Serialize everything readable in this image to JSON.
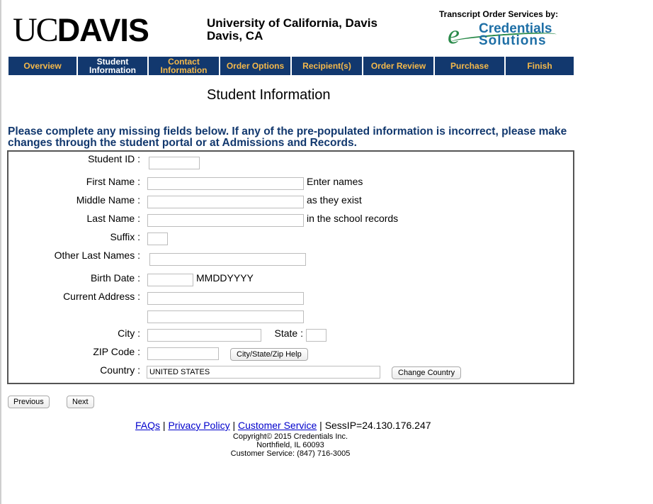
{
  "header": {
    "logo_uc": "UC",
    "logo_davis": "DAVIS",
    "university_line1": "University of California, Davis",
    "university_line2": "Davis, CA",
    "services_label": "Transcript Order Services by:",
    "provider_e": "e",
    "provider_word1": "Credentials",
    "provider_word2": "Solutions"
  },
  "nav": {
    "tabs": [
      {
        "label": "Overview",
        "active": false
      },
      {
        "label": "Student Information",
        "active": true
      },
      {
        "label": "Contact Information",
        "active": false
      },
      {
        "label": "Order Options",
        "active": false
      },
      {
        "label": "Recipient(s)",
        "active": false
      },
      {
        "label": "Order Review",
        "active": false
      },
      {
        "label": "Purchase",
        "active": false
      },
      {
        "label": "Finish",
        "active": false
      }
    ]
  },
  "page_title": "Student Information",
  "instructions": "Please complete any missing fields below. If any of the pre-populated information is incorrect, please make changes through the student portal or at Admissions and Records.",
  "form": {
    "student_id_label": "Student ID :",
    "first_name_label": "First Name :",
    "middle_name_label": "Middle Name :",
    "last_name_label": "Last Name :",
    "suffix_label": "Suffix :",
    "other_last_names_label": "Other Last Names :",
    "birth_date_label": "Birth Date :",
    "birth_date_format": "MMDDYYYY",
    "current_address_label": "Current Address :",
    "city_label": "City :",
    "state_label": "State :",
    "zip_label": "ZIP Code :",
    "country_label": "Country :",
    "country_value": "UNITED STATES",
    "names_note_1": "Enter names",
    "names_note_2": "as they exist",
    "names_note_3": "in the school records",
    "city_state_zip_help_button": "City/State/Zip Help",
    "change_country_button": "Change Country"
  },
  "buttons": {
    "previous": "Previous",
    "next": "Next"
  },
  "footer": {
    "faqs": "FAQs",
    "sep": "|",
    "privacy": "Privacy Policy",
    "customer_service": "Customer Service",
    "sess_ip": "SessIP=24.130.176.247",
    "copyright": "Copyright© 2015 Credentials Inc.",
    "address": "Northfield, IL 60093",
    "phone": "Customer Service: (847) 716-3005"
  },
  "colors": {
    "nav_bg": "#12386e",
    "nav_text": "#f5b94a",
    "nav_active_text": "#ffffff",
    "instructions_text": "#12386e",
    "link": "#0000cc"
  }
}
